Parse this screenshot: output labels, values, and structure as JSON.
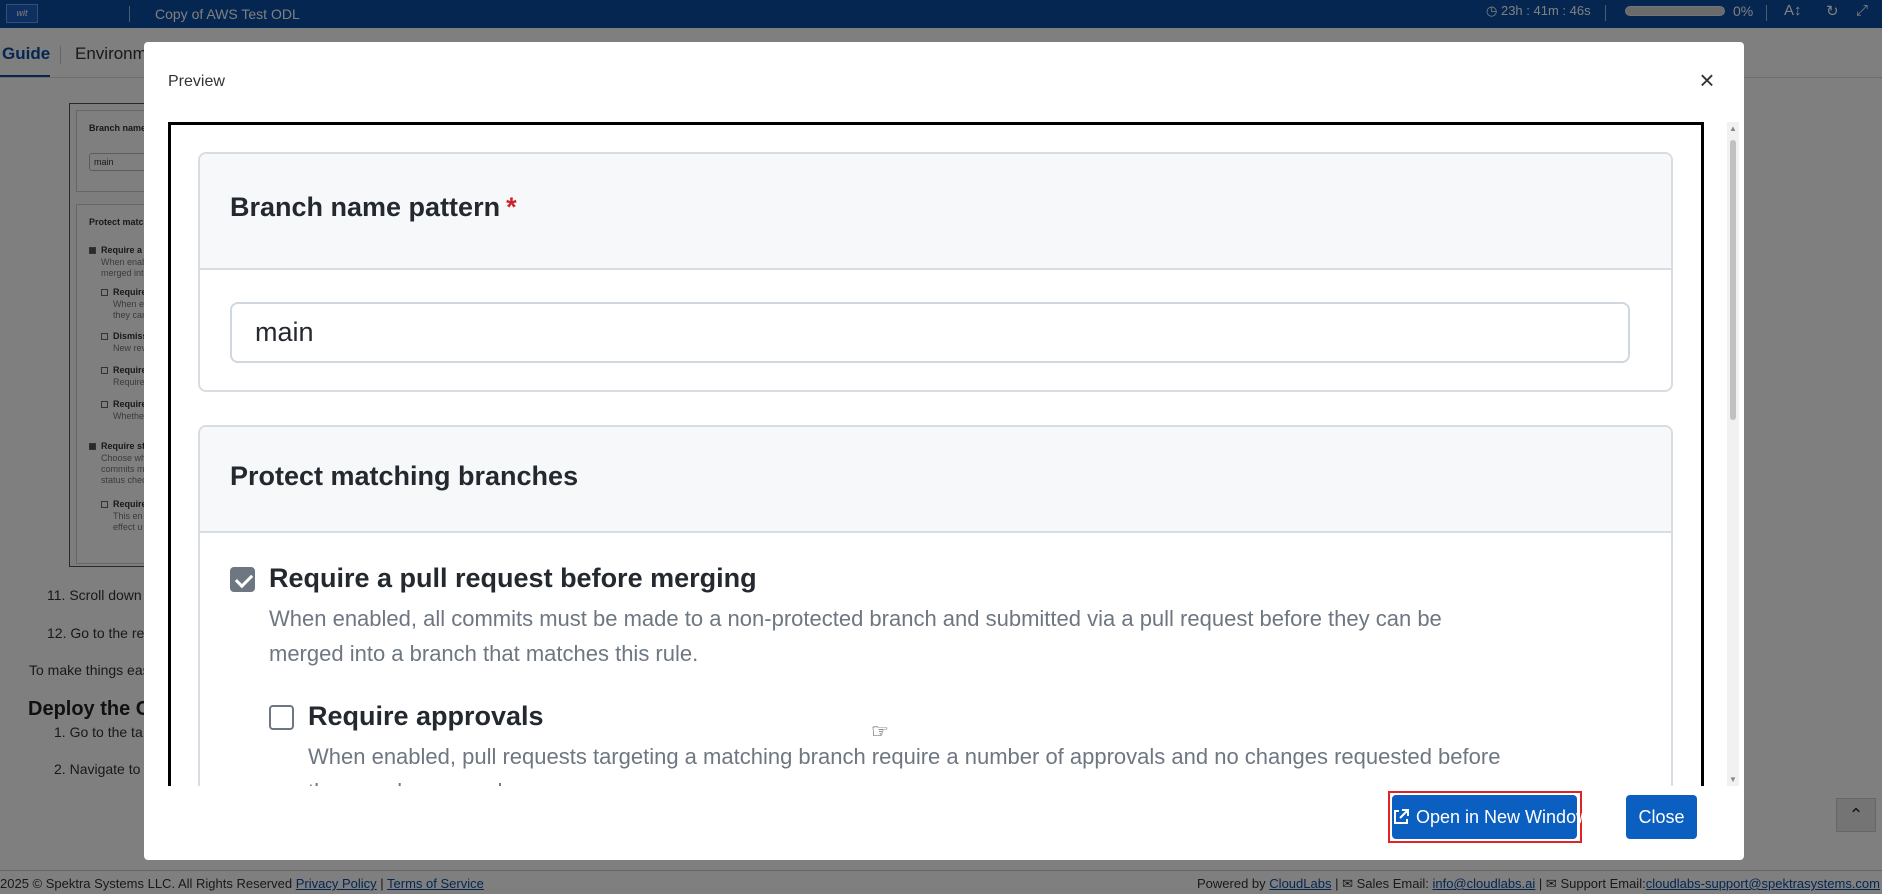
{
  "topbar": {
    "logo": "wit",
    "lab_title": "Copy of AWS Test ODL",
    "timer": "23h : 41m : 46s",
    "progress_fraction": 0.0,
    "progress_text": "0%",
    "font_size_label": "A"
  },
  "tabs": [
    {
      "label": "Guide",
      "active": true
    },
    {
      "label": "Environme",
      "active": false
    }
  ],
  "guide": {
    "thumbnail": {
      "branch_label": "Branch name",
      "input_value": "main",
      "protect_label": "Protect matc",
      "items": [
        {
          "label": "Require a",
          "desc1": "When enabl",
          "desc2": "merged into",
          "checked": true
        },
        {
          "label": "Require",
          "desc1": "When en",
          "desc2": "they can",
          "checked": false
        },
        {
          "label": "Dismiss",
          "desc1": "New revi",
          "checked": false
        },
        {
          "label": "Require",
          "desc1": "Require:",
          "checked": false
        },
        {
          "label": "Require",
          "desc1": "Whether",
          "checked": false
        },
        {
          "label": "Require st",
          "desc1": "Choose whi",
          "desc2": "commits m",
          "desc3": "status checl",
          "checked": true
        },
        {
          "label": "Require",
          "desc1": "This en",
          "desc2": "effect u",
          "checked": false
        }
      ]
    },
    "steps": [
      {
        "num": "11.",
        "text": "Scroll down"
      },
      {
        "num": "12.",
        "text": "Go to the re"
      }
    ],
    "paragraph": "To make things eas",
    "heading": "Deploy the C",
    "steps2": [
      {
        "num": "1.",
        "text": "Go to the ta"
      },
      {
        "num": "2.",
        "text": "Navigate to"
      }
    ]
  },
  "footer": {
    "copyright": "2025 © Spektra Systems LLC. All Rights Reserved",
    "privacy": "Privacy Policy",
    "terms": "Terms of Service",
    "powered_by": "Powered by",
    "cloudlabs": "CloudLabs",
    "sales_label": "Sales Email:",
    "sales_email": "info@cloudlabs.ai",
    "support_label": "Support Email:",
    "support_email": "cloudlabs-support@spektrasystems.com"
  },
  "modal": {
    "title": "Preview",
    "close_icon": "×",
    "branch_heading": "Branch name pattern",
    "required_marker": "*",
    "branch_input_value": "main",
    "protect_heading": "Protect matching branches",
    "option1": {
      "label": "Require a pull request before merging",
      "desc_line1": "When enabled, all commits must be made to a non-protected branch and submitted via a pull request before they can be",
      "desc_line2": "merged into a branch that matches this rule.",
      "checked": true
    },
    "option2": {
      "label": "Require approvals",
      "desc_line1": "When enabled, pull requests targeting a matching branch require a number of approvals and no changes requested before",
      "desc_line2": "they can be merged.",
      "checked": false
    },
    "open_button": "Open in New Window",
    "close_button": "Close"
  },
  "colors": {
    "brand_blue": "#0a4da3",
    "button_blue": "#0b5fc1",
    "highlight_red": "#e02424",
    "required_red": "#cf222e"
  },
  "icons": [
    "clock-icon",
    "font-size-icon",
    "refresh-icon",
    "expand-icon",
    "close-icon",
    "external-link-icon",
    "envelope-icon",
    "chevron-up-icon"
  ]
}
